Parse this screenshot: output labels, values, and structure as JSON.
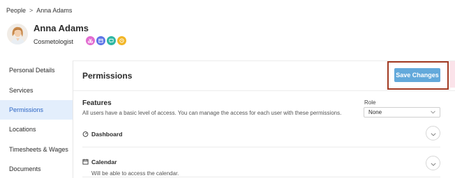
{
  "breadcrumb": {
    "parent": "People",
    "separator": ">",
    "current": "Anna Adams"
  },
  "profile": {
    "name": "Anna Adams",
    "role": "Cosmetologist"
  },
  "badges": [
    {
      "icon": "scissors-icon",
      "color": "#e26bd0"
    },
    {
      "icon": "calendar-icon",
      "color": "#5c74e8"
    },
    {
      "icon": "message-icon",
      "color": "#2fb7a3"
    },
    {
      "icon": "clock-icon",
      "color": "#f2b627"
    }
  ],
  "sidebar": {
    "items": [
      {
        "label": "Personal Details",
        "active": false
      },
      {
        "label": "Services",
        "active": false
      },
      {
        "label": "Permissions",
        "active": true
      },
      {
        "label": "Locations",
        "active": false
      },
      {
        "label": "Timesheets & Wages",
        "active": false
      },
      {
        "label": "Documents",
        "active": false
      }
    ]
  },
  "main": {
    "title": "Permissions",
    "save_label": "Save Changes",
    "features_title": "Features",
    "features_desc": "All users have a basic level of access. You can manage the access for each user with these permissions.",
    "role_label": "Role",
    "role_value": "None",
    "permissions": [
      {
        "icon": "gauge-icon",
        "title": "Dashboard",
        "desc": ""
      },
      {
        "icon": "calendar-icon",
        "title": "Calendar",
        "desc": "Will be able to access the calendar."
      }
    ]
  },
  "colors": {
    "accent": "#63a9db",
    "active_bg": "#e3eefc",
    "active_text": "#2a64c4",
    "highlight_frame": "#a23a22"
  }
}
